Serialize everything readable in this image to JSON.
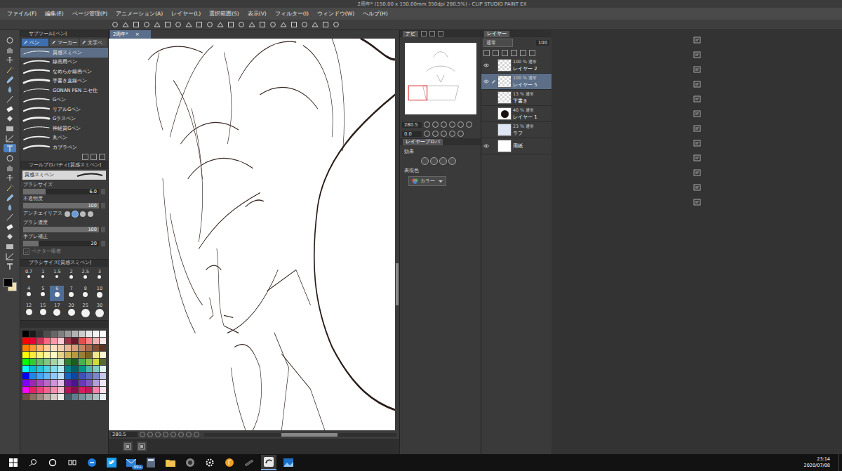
{
  "window": {
    "title": "2周年* (150.00 x 150.00mm 350dpi 280.5%) - CLIP STUDIO PAINT EX"
  },
  "menu": [
    "ファイル(F)",
    "編集(E)",
    "ページ管理(P)",
    "アニメーション(A)",
    "レイヤー(L)",
    "選択範囲(S)",
    "表示(V)",
    "フィルター(I)",
    "ウィンドウ(W)",
    "ヘルプ(H)"
  ],
  "tools": [
    {
      "selected": false
    },
    {
      "selected": false
    },
    {
      "selected": false
    },
    {
      "selected": false
    },
    {
      "selected": false
    },
    {
      "selected": false
    },
    {
      "selected": false
    },
    {
      "selected": false
    },
    {
      "selected": false
    },
    {
      "selected": false
    },
    {
      "selected": false
    },
    {
      "selected": true
    },
    {
      "selected": false
    },
    {
      "selected": false
    },
    {
      "selected": false
    },
    {
      "selected": false
    },
    {
      "selected": false
    },
    {
      "selected": false
    },
    {
      "selected": false
    },
    {
      "selected": false
    },
    {
      "selected": false
    },
    {
      "selected": false
    },
    {
      "selected": false
    },
    {
      "selected": false
    }
  ],
  "colors": {
    "main": "#000000",
    "sub": "#f3e3b0"
  },
  "subtool": {
    "title": "サブツール[ペン]",
    "tabs": [
      {
        "label": "ペン",
        "selected": true
      },
      {
        "label": "マーカー",
        "selected": false
      },
      {
        "label": "文字ペ",
        "selected": false
      }
    ],
    "brushes": [
      {
        "name": "質感スミペン",
        "selected": true
      },
      {
        "name": "線画用ペン",
        "selected": false
      },
      {
        "name": "なめらか線画ペン",
        "selected": false
      },
      {
        "name": "手書き直線ペン",
        "selected": false
      },
      {
        "name": "GONAN PEN ニセ仕",
        "selected": false
      },
      {
        "name": "Gペン",
        "selected": false
      },
      {
        "name": "リアルGペン",
        "selected": false
      },
      {
        "name": "Gラスペン",
        "selected": false
      },
      {
        "name": "神経質Gペン",
        "selected": false
      },
      {
        "name": "丸ペン",
        "selected": false
      },
      {
        "name": "カブラペン",
        "selected": false
      }
    ]
  },
  "tool_property": {
    "title": "ツールプロパティ[質感スミペン]",
    "brush": "質感スミペン",
    "rows": [
      {
        "label": "ブラシサイズ",
        "kind": "slider",
        "value": "6.0",
        "level": 0.3
      },
      {
        "label": "不透明度",
        "kind": "slider",
        "value": "100",
        "level": 1
      },
      {
        "label": "アンチエイリアス",
        "kind": "choice",
        "options": [
          {
            "selected": false
          },
          {
            "selected": true
          },
          {
            "selected": false
          },
          {
            "selected": false
          }
        ]
      },
      {
        "label": "ブラシ濃度",
        "kind": "slider",
        "value": "100",
        "level": 1
      },
      {
        "label": "手ブレ補正",
        "kind": "slider",
        "value": "20",
        "level": 0.2
      },
      {
        "label": "ベクター吸着",
        "kind": "check",
        "checked": true,
        "disabled": true
      }
    ]
  },
  "brush_size": {
    "title": "ブラシサイズ[質感スミペン]",
    "sizes": [
      {
        "label": "0.7",
        "selected": false
      },
      {
        "label": "1",
        "selected": false
      },
      {
        "label": "1.5",
        "selected": false
      },
      {
        "label": "2",
        "selected": false
      },
      {
        "label": "2.5",
        "selected": false
      },
      {
        "label": "3",
        "selected": false
      },
      {
        "label": "4",
        "selected": false
      },
      {
        "label": "5",
        "selected": false
      },
      {
        "label": "6",
        "selected": true
      },
      {
        "label": "7",
        "selected": false
      },
      {
        "label": "8",
        "selected": false
      },
      {
        "label": "10",
        "selected": false
      },
      {
        "label": "12",
        "selected": false
      },
      {
        "label": "15",
        "selected": false
      },
      {
        "label": "17",
        "selected": false
      },
      {
        "label": "20",
        "selected": false
      },
      {
        "label": "25",
        "selected": false
      },
      {
        "label": "30",
        "selected": false
      }
    ]
  },
  "palette": [
    "#000000",
    "#1a1a1a",
    "#333333",
    "#4d4d4d",
    "#666666",
    "#808080",
    "#999999",
    "#b3b3b3",
    "#cccccc",
    "#e6e6e6",
    "#f2f2f2",
    "#ffffff",
    "#ff0000",
    "#e60033",
    "#cc3355",
    "#ff6680",
    "#ff99aa",
    "#ffccd5",
    "#993344",
    "#661a2a",
    "#e64d4d",
    "#ff8080",
    "#f2b3b3",
    "#ffe6e6",
    "#ff8000",
    "#ff9933",
    "#ffb366",
    "#ffcc99",
    "#ffe0c2",
    "#f5d0b0",
    "#e8b896",
    "#d9a07a",
    "#c48660",
    "#a66b48",
    "#804d33",
    "#5c3322",
    "#ffff00",
    "#ffeb3b",
    "#fff176",
    "#fff59d",
    "#fff9c4",
    "#e6d28a",
    "#ccb35c",
    "#b39b45",
    "#998033",
    "#806622",
    "#f0e68c",
    "#fafad2",
    "#00ff00",
    "#33cc33",
    "#66bb6a",
    "#81c784",
    "#a5d6a7",
    "#c8e6c9",
    "#2e7d32",
    "#1b5e20",
    "#4caf50",
    "#8bc34a",
    "#cddc39",
    "#556b2f",
    "#00ffff",
    "#00bcd4",
    "#26c6da",
    "#4dd0e1",
    "#80deea",
    "#b2ebf2",
    "#00838f",
    "#006064",
    "#009688",
    "#4db6ac",
    "#80cbc4",
    "#e0f2f1",
    "#0000ff",
    "#1e88e5",
    "#42a5f5",
    "#64b5f6",
    "#90caf9",
    "#bbdefb",
    "#1565c0",
    "#0d47a1",
    "#3f51b5",
    "#5c6bc0",
    "#7986cb",
    "#c5cae9",
    "#8000ff",
    "#9c27b0",
    "#ab47bc",
    "#ba68c8",
    "#ce93d8",
    "#e1bee7",
    "#6a1b9a",
    "#4a148c",
    "#673ab7",
    "#7e57c2",
    "#b39ddb",
    "#ede7f6",
    "#ff00ff",
    "#e91e63",
    "#ec407a",
    "#f06292",
    "#f48fb1",
    "#f8bbd0",
    "#ad1457",
    "#880e4f",
    "#d81b60",
    "#c2185b",
    "#ff80ab",
    "#fce4ec",
    "#6d4c41",
    "#8d6e63",
    "#a1887f",
    "#bcaaa4",
    "#d7ccc8",
    "#efebe9",
    "#455a64",
    "#607d8b",
    "#78909c",
    "#90a4ae",
    "#b0bec5",
    "#eceff1"
  ],
  "document_tab": {
    "label": "2周年*",
    "close": "×"
  },
  "canvas_status": {
    "zoom": "280.5"
  },
  "navigator": {
    "tab": "ナビ",
    "zoom": "280.5",
    "rotation": "0.0"
  },
  "layer_property": {
    "tab": "レイヤープロパ",
    "effect_label": "効果",
    "color_label": "表現色",
    "color_mode": "カラー"
  },
  "layers": {
    "tab": "レイヤー",
    "blend": "通常",
    "opacity": "100",
    "items": [
      {
        "opacity": "100 %",
        "blend": "通常",
        "name": "レイヤー 2",
        "visible": true,
        "selected": false,
        "editing": false,
        "kind": "raster"
      },
      {
        "opacity": "100 %",
        "blend": "通常",
        "name": "レイヤー 5",
        "visible": true,
        "selected": true,
        "editing": true,
        "kind": "raster"
      },
      {
        "opacity": "13 %",
        "blend": "通常",
        "name": "下書き",
        "visible": false,
        "selected": false,
        "editing": false,
        "kind": "raster"
      },
      {
        "opacity": "40 %",
        "blend": "通常",
        "name": "レイヤー 1",
        "visible": false,
        "selected": false,
        "editing": false,
        "kind": "circle"
      },
      {
        "opacity": "23 %",
        "blend": "通常",
        "name": "ラフ",
        "visible": false,
        "selected": false,
        "editing": false,
        "kind": "sketch"
      },
      {
        "opacity": "",
        "blend": "",
        "name": "用紙",
        "visible": true,
        "selected": false,
        "editing": false,
        "kind": "paper"
      }
    ]
  },
  "taskbar": {
    "mail_badge": "99+",
    "time": "23:14",
    "date": "2020/07/08"
  }
}
